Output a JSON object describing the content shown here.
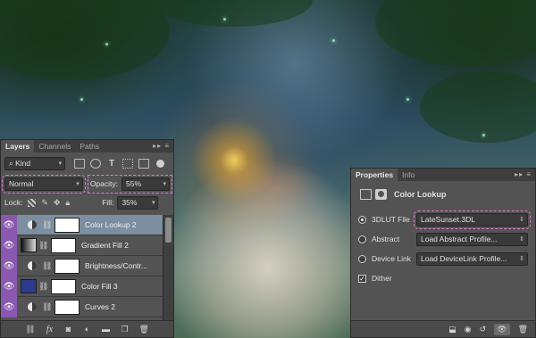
{
  "layers_panel": {
    "tabs": [
      {
        "label": "Layers"
      },
      {
        "label": "Channels"
      },
      {
        "label": "Paths"
      }
    ],
    "panel_tools": "▸▸ ≡",
    "filter": {
      "kind_label": "Kind",
      "search_icon": "search-icon"
    },
    "blend_mode": "Normal",
    "opacity_label": "Opacity:",
    "opacity_value": "55%",
    "lock_label": "Lock:",
    "fill_label": "Fill:",
    "fill_value": "35%",
    "layers": [
      {
        "name": "Color Lookup 2",
        "type": "adjustment",
        "selected": true
      },
      {
        "name": "Gradient Fill 2",
        "type": "gradient",
        "selected": false
      },
      {
        "name": "Brightness/Contr...",
        "type": "adjustment",
        "selected": false
      },
      {
        "name": "Color Fill 3",
        "type": "fill",
        "selected": false
      },
      {
        "name": "Curves 2",
        "type": "adjustment",
        "selected": false
      }
    ],
    "footer_icons": [
      "link-icon",
      "fx-icon",
      "add-mask-icon",
      "adjustment-icon",
      "folder-icon",
      "new-layer-icon",
      "trash-icon"
    ],
    "footer_fx": "fx"
  },
  "properties_panel": {
    "tabs": [
      {
        "label": "Properties"
      },
      {
        "label": "Info"
      }
    ],
    "panel_tools": "▸▸ ≡",
    "title": "Color Lookup",
    "options": [
      {
        "label": "3DLUT File",
        "value": "LateSunset.3DL",
        "selected": true
      },
      {
        "label": "Abstract",
        "value": "Load Abstract Profile...",
        "selected": false
      },
      {
        "label": "Device Link",
        "value": "Load DeviceLink Profile...",
        "selected": false
      }
    ],
    "dither_label": "Dither",
    "dither_checked": true
  },
  "colors": {
    "panel_bg": "#535353",
    "selected_layer": "#7c8ea0",
    "visibility_column": "#8a58b0",
    "highlight_dash": "#e07ad0",
    "color_fill_swatch": "#2c3b8c"
  }
}
